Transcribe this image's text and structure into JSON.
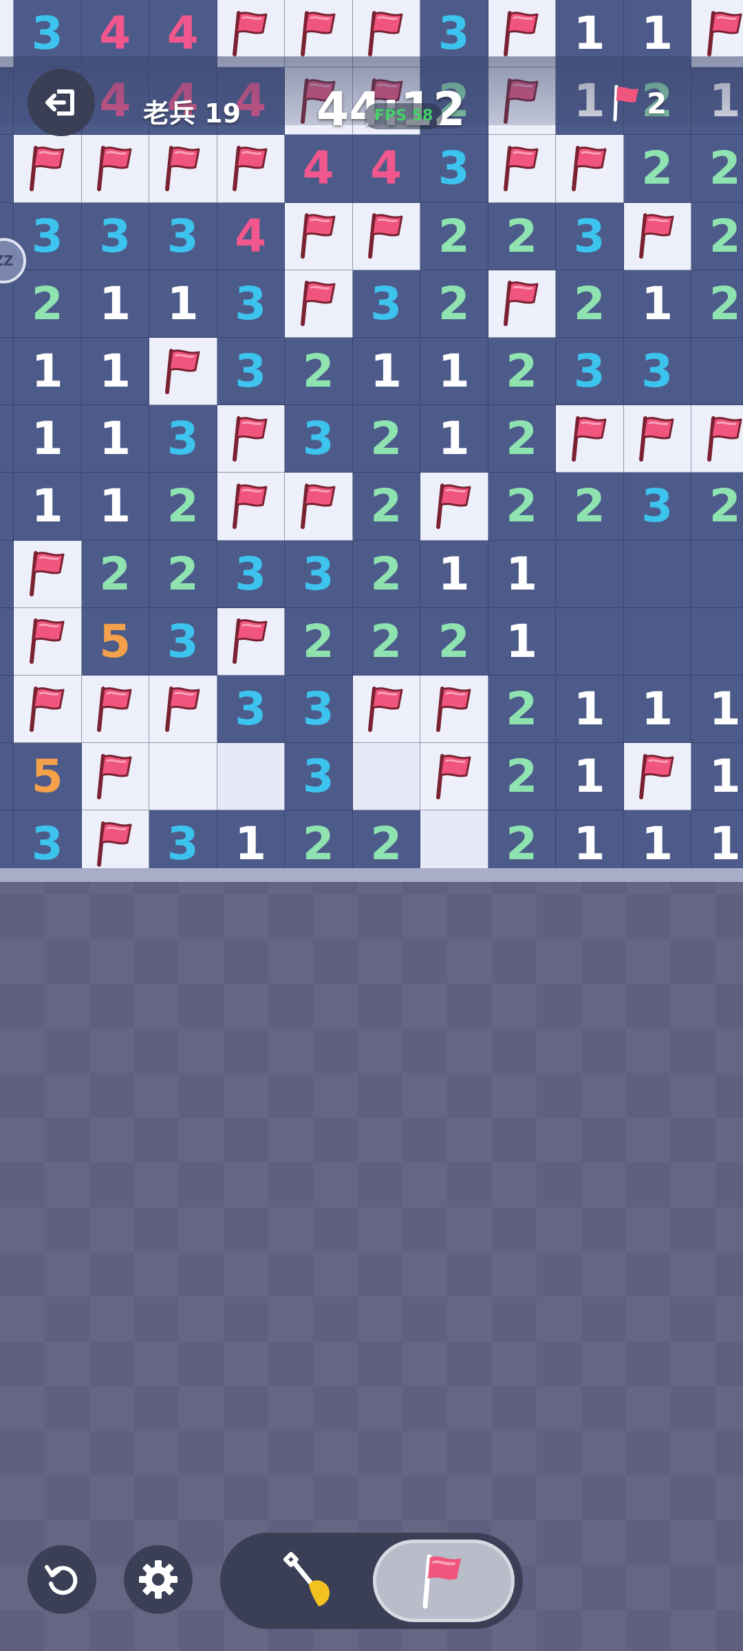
{
  "hud": {
    "level_label": "老兵 19",
    "timer": "44:12",
    "fps": "FPS 58",
    "flag_count": "2",
    "side_badge": "ZZ"
  },
  "colors": {
    "n1": "#ffffff",
    "n2": "#8ee3b0",
    "n3": "#3cc3ee",
    "n4": "#f0578c",
    "n5": "#f5a04a",
    "flag": "#f0557e"
  },
  "board": {
    "grid": [
      "F344FFF3F11F",
      "?4444FF2F121",
      "?FFFF443FF22",
      ".3334FF223F2",
      ".2113F32F212",
      ".11F3211233?",
      ".113F3212FFF",
      ".112FF2F2232",
      ".F2233211???",
      ".F53F2221???",
      ".FFF33FF2111",
      ".5F  3 F21F1",
      ".3F3122 2111"
    ]
  },
  "controls": {
    "back_icon": "exit-icon",
    "restart_icon": "restart-icon",
    "settings_icon": "gear-icon",
    "dig_icon": "shovel-icon",
    "flag_icon": "flag-icon"
  }
}
